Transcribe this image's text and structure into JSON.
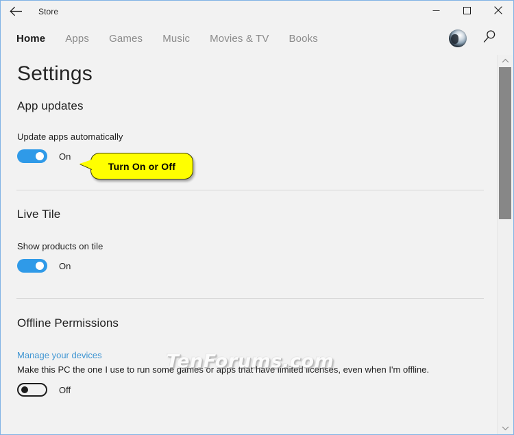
{
  "window": {
    "app_title": "Store",
    "back_icon": "back-arrow-icon",
    "minimize_label": "–",
    "maximize_label": "☐",
    "close_label": "✕"
  },
  "nav": {
    "items": [
      {
        "label": "Home",
        "selected": true
      },
      {
        "label": "Apps",
        "selected": false
      },
      {
        "label": "Games",
        "selected": false
      },
      {
        "label": "Music",
        "selected": false
      },
      {
        "label": "Movies & TV",
        "selected": false
      },
      {
        "label": "Books",
        "selected": false
      }
    ],
    "avatar_icon": "user-avatar-icon",
    "search_icon": "search-icon"
  },
  "page": {
    "title": "Settings"
  },
  "sections": {
    "app_updates": {
      "heading": "App updates",
      "field_label": "Update apps automatically",
      "toggle_state": "On",
      "toggle_on": true
    },
    "live_tile": {
      "heading": "Live Tile",
      "field_label": "Show products on tile",
      "toggle_state": "On",
      "toggle_on": true
    },
    "offline_permissions": {
      "heading": "Offline Permissions",
      "link_text": "Manage your devices",
      "description": "Make this PC the one I use to run some games or apps that have limited licenses, even when I'm offline.",
      "toggle_state": "Off",
      "toggle_on": false
    }
  },
  "callout": {
    "text": "Turn On or Off",
    "background_color": "#ffff00",
    "text_color": "#000000"
  },
  "watermark": {
    "text": "TenForums.com"
  },
  "scrollbar": {
    "up_arrow": "chevron-up-icon",
    "down_arrow": "chevron-down-icon"
  },
  "colors": {
    "accent_toggle_on": "#2f9ae8",
    "link_blue": "#3f95d2",
    "window_border": "#7fb2e5",
    "page_background": "#f2f2f2"
  }
}
